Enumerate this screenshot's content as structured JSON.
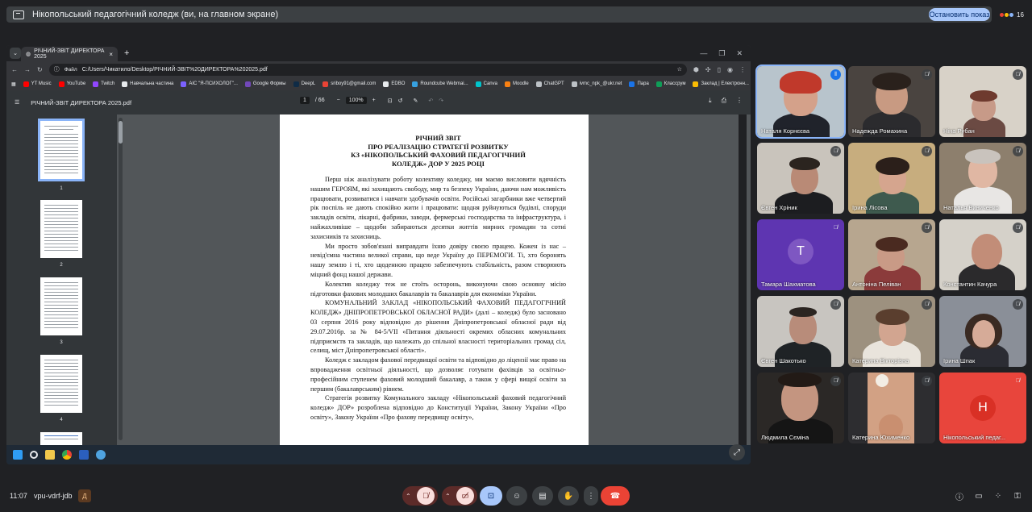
{
  "banner": {
    "title": "Нікопольський педагогічний коледж (ви, на главном экране)",
    "stop_label": "Остановить показ",
    "participant_count": "16"
  },
  "browser": {
    "tab_title": "РІЧНИЙ-ЗВІТ ДИРЕКТОРА 2025",
    "url_chip": "Файл",
    "url": "C:/Users/Чикатило/Desktop/РІЧНИЙ-ЗВІТ%20ДИРЕКТОРА%202025.pdf",
    "bookmarks": [
      "YT Music",
      "YouTube",
      "Twitch",
      "Навчальна частина",
      "АІС \"Я-ПСИХОЛОГ\"...",
      "Google Формы",
      "DeepL",
      "sriboy91@gmail.com",
      "EDBO",
      "Roundcube Webmai...",
      "Canva",
      "Moodle",
      "ChatGPT",
      "ivmc_npk_@ukr.net",
      "Пара",
      "Классрум",
      "Заклад | Електронн..."
    ]
  },
  "pdf": {
    "file_name": "РІЧНИЙ-ЗВІТ ДИРЕКТОРА 2025.pdf",
    "page_current": "1",
    "page_total": "/ 66",
    "zoom": "100%",
    "thumb_numbers": [
      "1",
      "2",
      "3",
      "4"
    ],
    "title_lines": [
      "РІЧНИЙ ЗВІТ",
      "ПРО РЕАЛІЗАЦІЮ СТРАТЕГІЇ РОЗВИТКУ",
      "КЗ «НІКОПОЛЬСЬКИЙ ФАХОВИЙ ПЕДАГОГІЧНИЙ",
      "КОЛЕДЖ» ДОР У 2025 РОЦІ"
    ],
    "paragraphs": [
      "Перш ніж аналізувати роботу колективу коледжу, ми маємо висловити вдячність нашим ГЕРОЯМ, які захищають свободу, мир та безпеку України, даючи нам можливість працювати, розвиватися і навчати здобувачів освіти. Російські загарбники вже четвертий рік поспіль не дають спокійно жити і працювати: щодня руйнуються будівлі, споруди закладів освіти, лікарні, фабрики, заводи, фермерські господарства та інфраструктура, і найжахливіше – щодоби забираються десятки життів мирних громадян та сотні захисників та захисниць.",
      "Ми просто зобов'язані виправдати їхню довіру своєю працею. Кожен із нас – невід'ємна частина великої справи, що веде Україну до ПЕРЕМОГИ. Ті, хто боронять нашу землю і ті, хто щоденною працею забезпечують стабільність, разом створюють міцний фонд нашої держави.",
      "Колектив коледжу теж не стоїть осторонь, виконуючи свою основну місію підготовки фахових молодших бакалаврів та бакалаврів для економіки України.",
      "КОМУНАЛЬНИЙ ЗАКЛАД «НІКОПОЛЬСЬКИЙ ФАХОВИЙ ПЕДАГОГІЧНИЙ КОЛЕДЖ» ДНІПРОПЕТРОВСЬКОЇ ОБЛАСНОЇ РАДИ» (далі – коледж) було засновано 03 серпня 2016 року відповідно до рішення Дніпропетровської обласної ради від 29.07.2016р. за № 84-5/VII «Питання діяльності окремих обласних комунальних підприємств та закладів, що належать до спільної власності територіальних громад сіл, селищ, міст Дніпропетровської області».",
      "Коледж є закладом фахової передвищої освіти та відповідно до ліцензії має право на впровадження освітньої діяльності, що дозволяє готувати фахівців за освітньо-професійним ступенем фаховий молодший бакалавр, а також у сфері вищої освіти за першим (бакалаврським) рівнем.",
      "Стратегія розвитку Комунального закладу «Нікопольський фаховий педагогічний коледж» ДОР» розроблена відповідно до Конституції України, Закону України «Про освіту», Закону України «Про фахову передвищу освіту»,"
    ]
  },
  "participants": [
    {
      "name": "Наталя Корнєєва",
      "mic": "speaking"
    },
    {
      "name": "Надежда Ромахина",
      "mic": "muted"
    },
    {
      "name": "Ніна Рубан",
      "mic": "muted"
    },
    {
      "name": "Євген Хріник",
      "mic": "muted"
    },
    {
      "name": "Ірина Лісова",
      "mic": "muted"
    },
    {
      "name": "Наталья Виниченко",
      "mic": "muted"
    },
    {
      "name": "Тамара Шахматова",
      "mic": "muted",
      "initial": "T",
      "color": "#5e35b1"
    },
    {
      "name": "Антоніна Пеліван",
      "mic": "muted"
    },
    {
      "name": "Константин Качура",
      "mic": "muted"
    },
    {
      "name": "Євген Шакотько",
      "mic": "muted"
    },
    {
      "name": "Катерина Вікторівна",
      "mic": "muted"
    },
    {
      "name": "Ірина Шпак",
      "mic": "muted"
    },
    {
      "name": "Людмила Сєміна",
      "mic": "muted"
    },
    {
      "name": "Катерина Юхименко",
      "mic": "muted"
    },
    {
      "name": "Нікопольський педаг...",
      "mic": "muted",
      "initial": "Н",
      "color": "#e8453c"
    }
  ],
  "bottom": {
    "time": "11:07",
    "meeting_code": "vpu-vdrf-jdb",
    "code_badge": "Д"
  },
  "colors": {
    "accent": "#a8c7fa",
    "end_call": "#ea4335",
    "muted_control": "#f9dedc",
    "present_control": "#a8c7fa"
  }
}
